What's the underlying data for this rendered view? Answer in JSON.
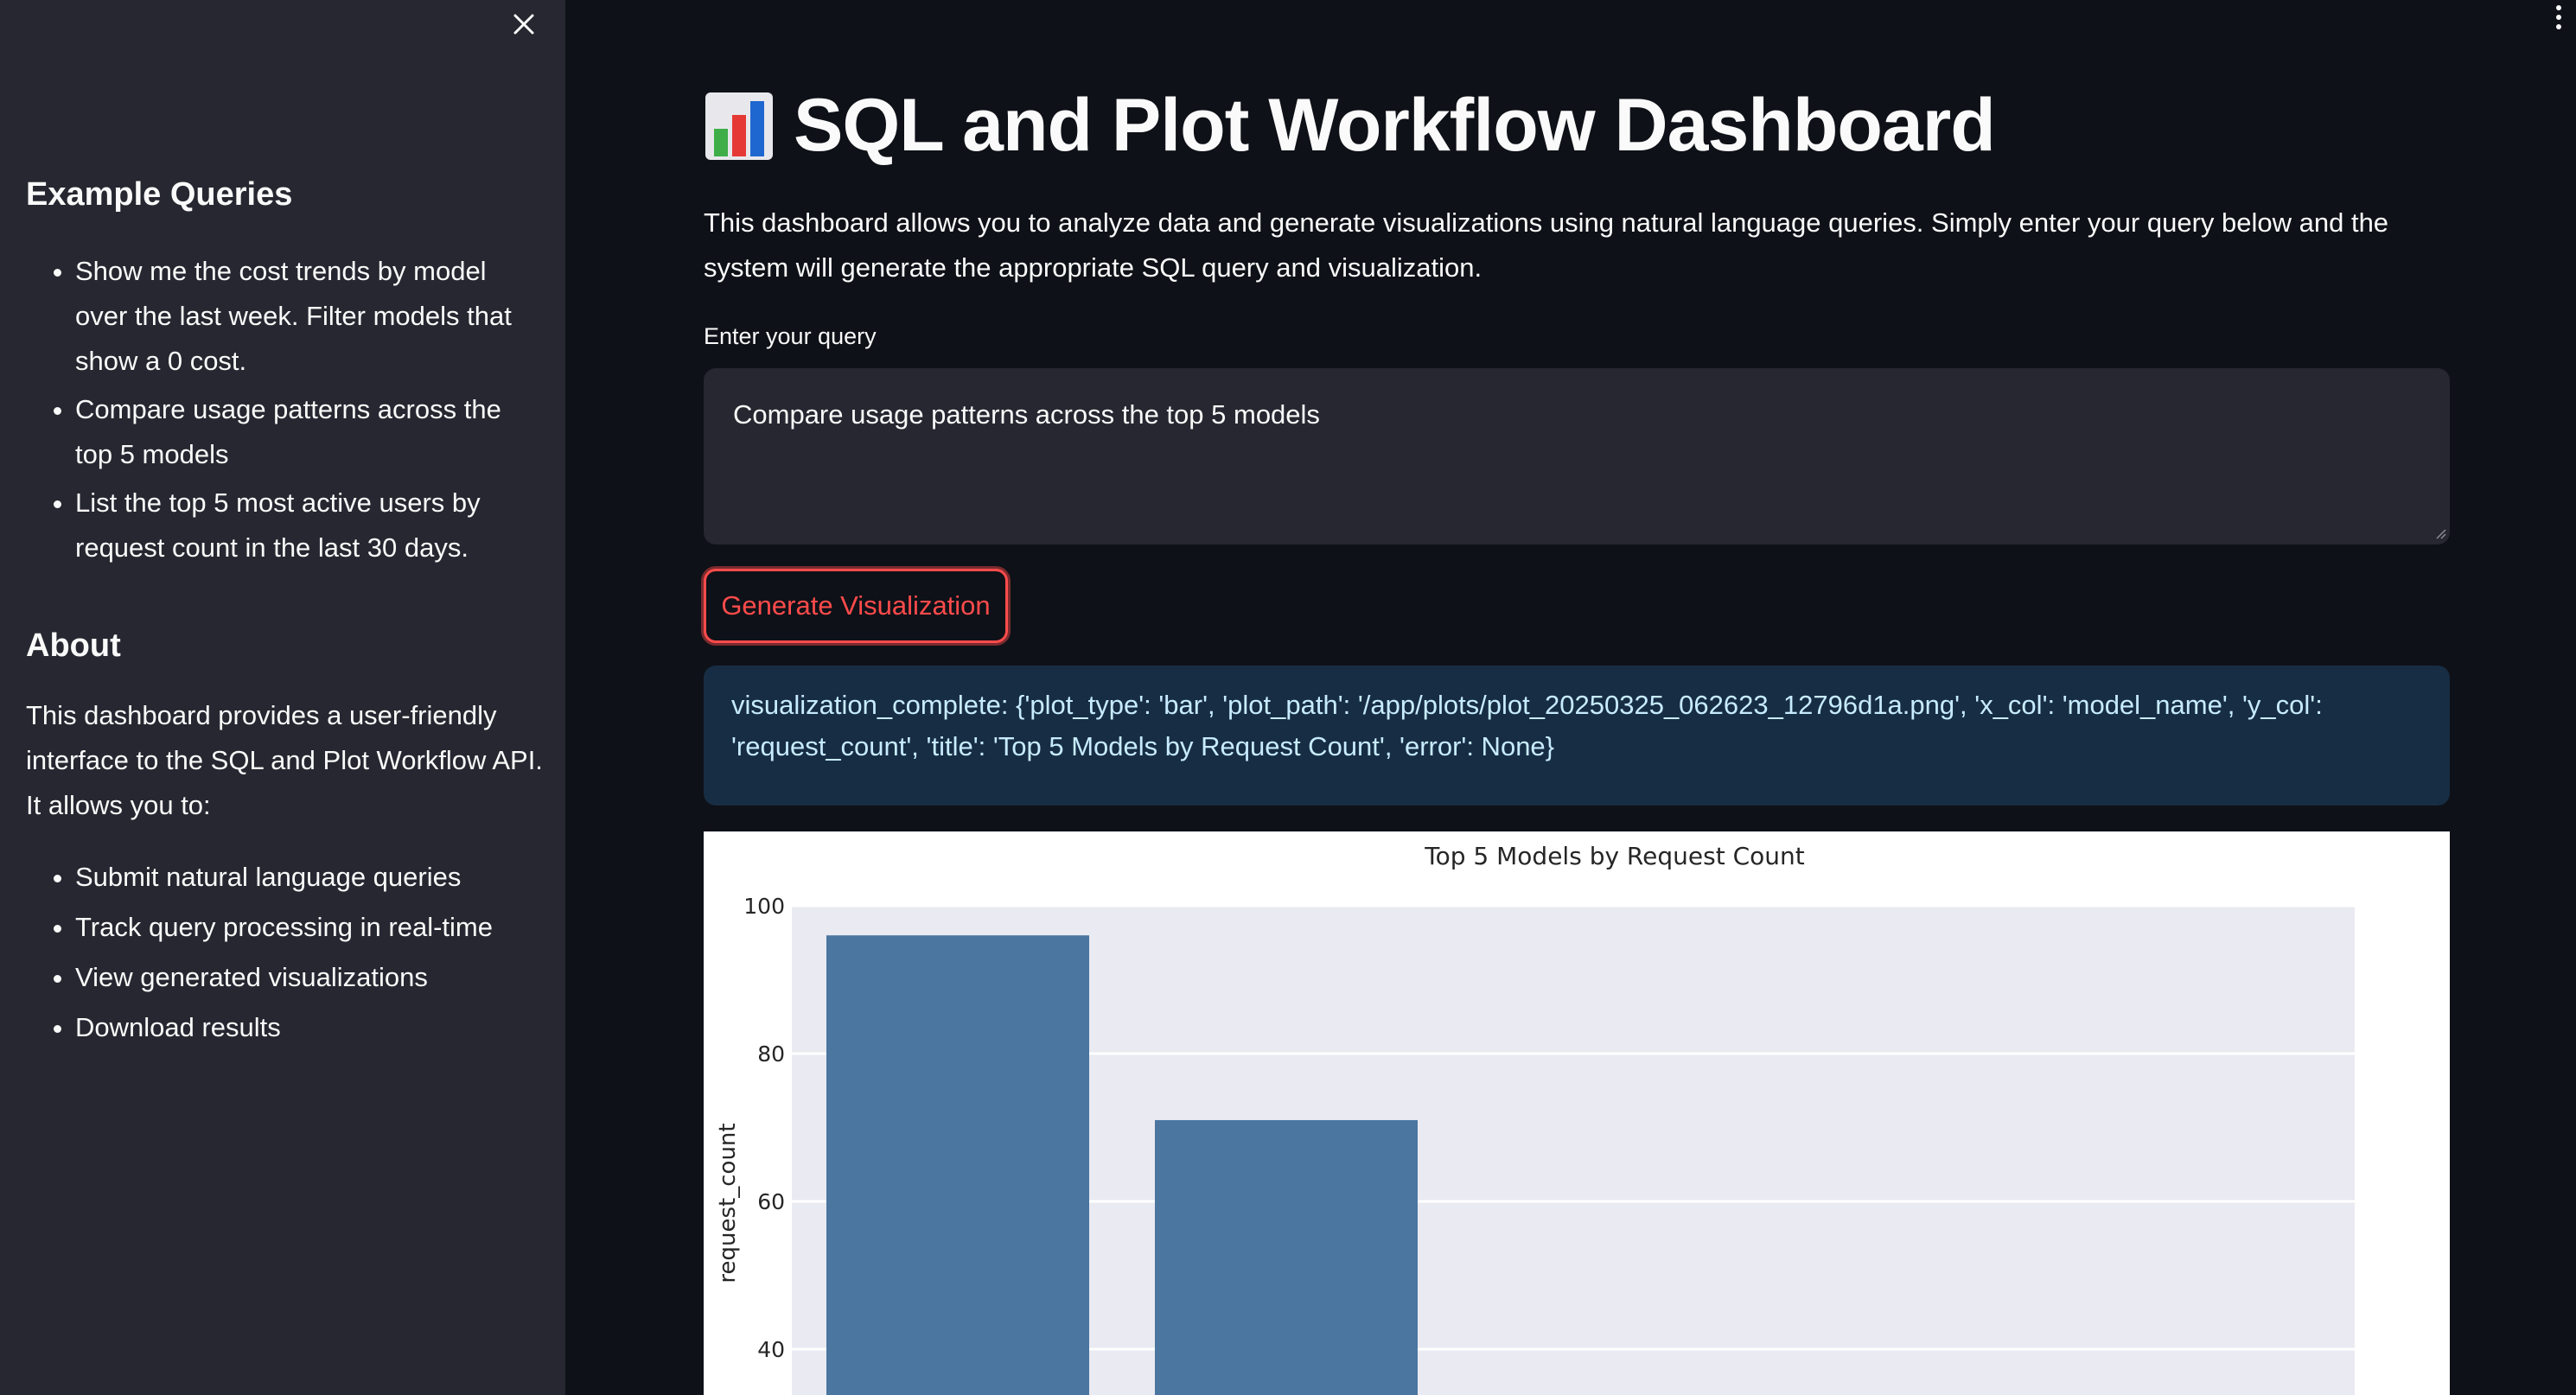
{
  "sidebar": {
    "examples_heading": "Example Queries",
    "examples": [
      "Show me the cost trends by model over the last week. Filter models that show a 0 cost.",
      "Compare usage patterns across the top 5 models",
      "List the top 5 most active users by request count in the last 30 days."
    ],
    "about_heading": "About",
    "about_text": "This dashboard provides a user-friendly interface to the SQL and Plot Workflow API. It allows you to:",
    "features": [
      "Submit natural language queries",
      "Track query processing in real-time",
      "View generated visualizations",
      "Download results"
    ]
  },
  "main": {
    "title": "SQL and Plot Workflow Dashboard",
    "intro": "This dashboard allows you to analyze data and generate visualizations using natural language queries. Simply enter your query below and the system will generate the appropriate SQL query and visualization.",
    "query_label": "Enter your query",
    "query_value": "Compare usage patterns across the top 5 models",
    "generate_button": "Generate Visualization",
    "status_message": "visualization_complete: {'plot_type': 'bar', 'plot_path': '/app/plots/plot_20250325_062623_12796d1a.png', 'x_col': 'model_name', 'y_col': 'request_count', 'title': 'Top 5 Models by Request Count', 'error': None}"
  },
  "icons": {
    "close": "close-icon",
    "menu": "kebab-menu-icon",
    "title_icon": "bar-chart-icon"
  },
  "colors": {
    "accent": "#ff4b4b",
    "info_bg": "#172d43",
    "bar": "#4a76a0"
  },
  "chart_data": {
    "type": "bar",
    "title": "Top 5 Models by Request Count",
    "xlabel": "",
    "ylabel": "request_count",
    "visible_ylim": [
      36,
      100
    ],
    "ylim": [
      0,
      100
    ],
    "yticks": [
      40,
      60,
      80,
      100
    ],
    "categories": [
      "",
      ""
    ],
    "values": [
      96,
      71
    ],
    "grid": true
  }
}
